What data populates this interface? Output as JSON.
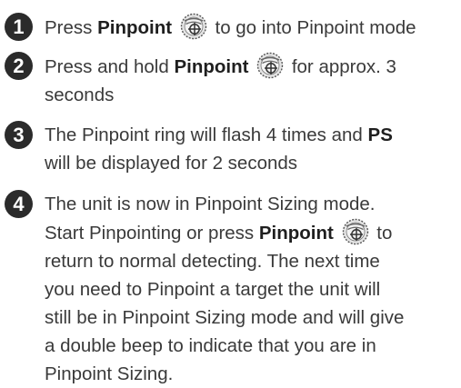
{
  "icon": "pinpoint-button-icon",
  "steps": [
    {
      "number": "1",
      "t1": "Press ",
      "b1": "Pinpoint",
      "t2": " to go into Pinpoint mode"
    },
    {
      "number": "2",
      "t1": "Press and hold ",
      "b1": "Pinpoint",
      "t2": " for approx. 3",
      "l2": "seconds"
    },
    {
      "number": "3",
      "t1": "The Pinpoint ring will flash 4 times and ",
      "b1": "PS",
      "l2": "will be displayed for 2 seconds"
    },
    {
      "number": "4",
      "l1": "The unit is now in Pinpoint Sizing mode.",
      "t1": "Start Pinpointing or press ",
      "b1": "Pinpoint",
      "t2": " to",
      "l3": "return to normal detecting. The next time",
      "l4": "you need to Pinpoint a target the unit will",
      "l5": "still be in Pinpoint Sizing mode and will give",
      "l6": "a double beep to indicate that you are in",
      "l7": "Pinpoint Sizing."
    }
  ]
}
